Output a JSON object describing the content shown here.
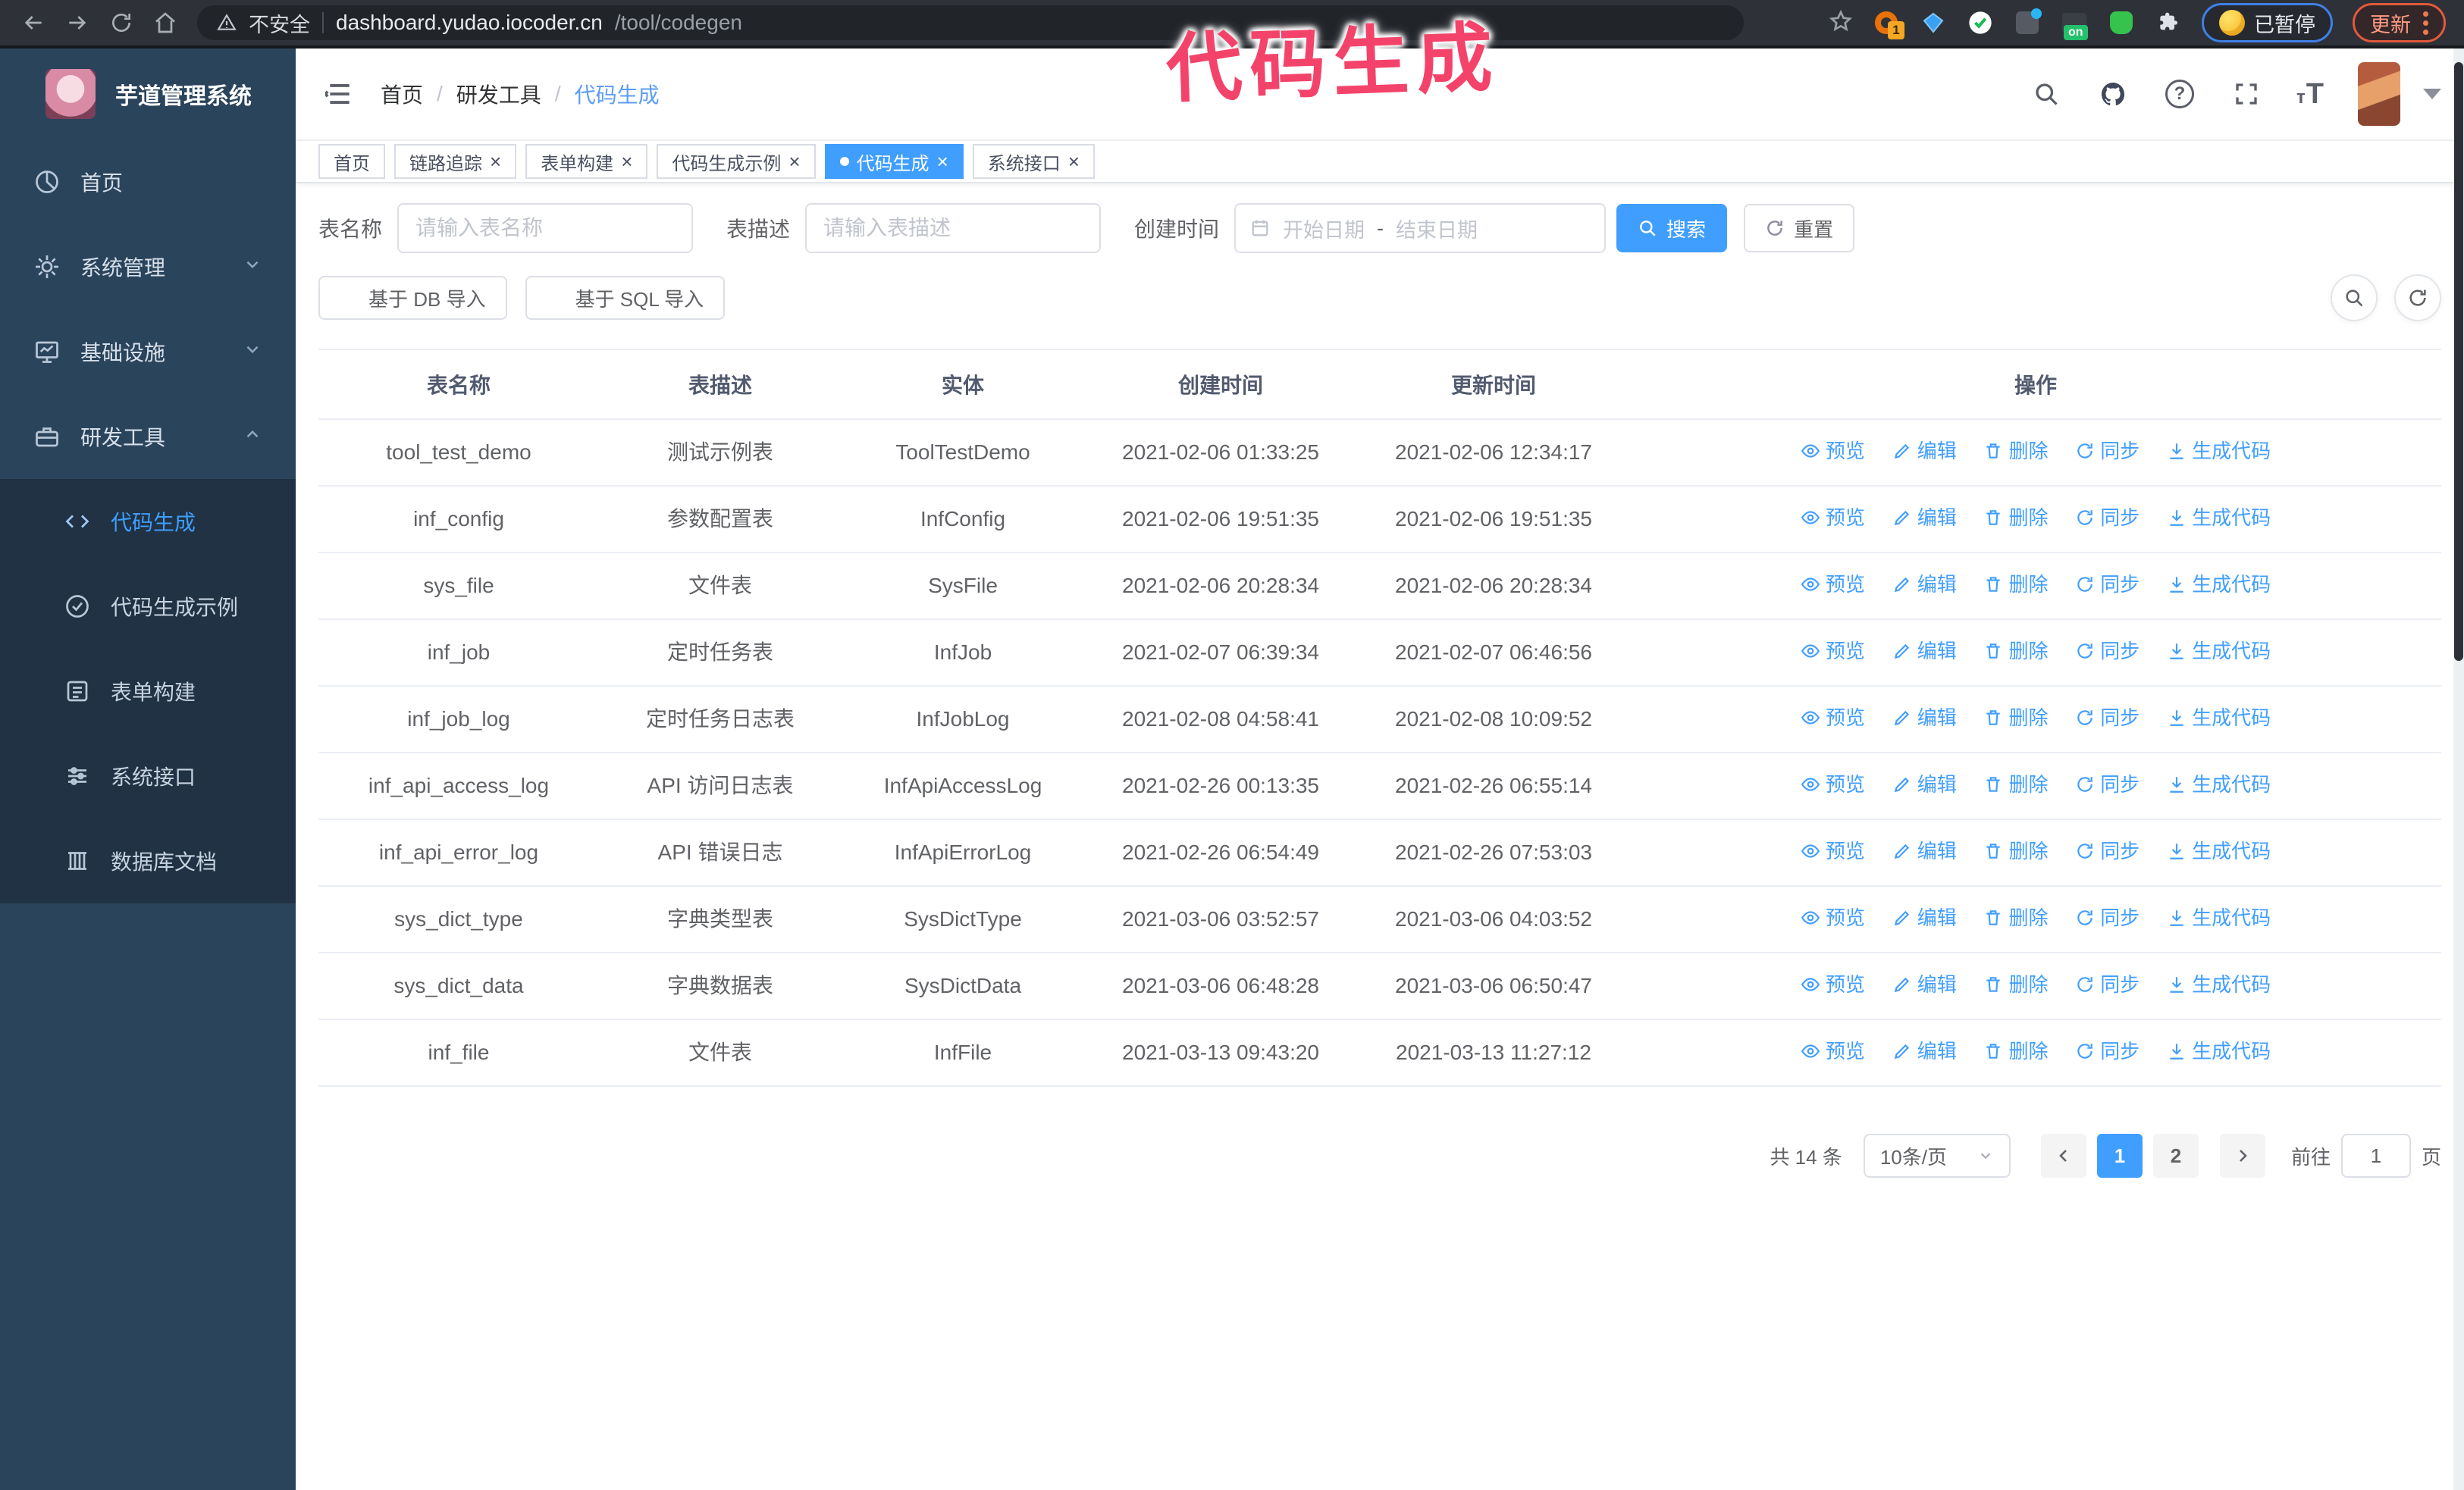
{
  "browser": {
    "security_label": "不安全",
    "url_host": "dashboard.yudao.iocoder.cn",
    "url_path": "/tool/codegen",
    "paused_chip": "已暂停",
    "update_chip": "更新"
  },
  "annotation": {
    "text": "代码生成",
    "color": "#f4436a"
  },
  "sidebar": {
    "logo_title": "芋道管理系统",
    "items": [
      {
        "label": "首页",
        "icon": "home-icon"
      },
      {
        "label": "系统管理",
        "icon": "gear-icon",
        "state": "collapsed"
      },
      {
        "label": "基础设施",
        "icon": "infrastructure-icon",
        "state": "collapsed"
      },
      {
        "label": "研发工具",
        "icon": "tools-icon",
        "state": "expanded"
      }
    ],
    "submenu": [
      {
        "label": "代码生成",
        "icon": "code-icon",
        "active": true
      },
      {
        "label": "代码生成示例",
        "icon": "example-check-icon",
        "active": false
      },
      {
        "label": "表单构建",
        "icon": "form-builder-icon",
        "active": false
      },
      {
        "label": "系统接口",
        "icon": "api-sliders-icon",
        "active": false
      },
      {
        "label": "数据库文档",
        "icon": "database-doc-icon",
        "active": false
      }
    ]
  },
  "breadcrumb": {
    "items": [
      "首页",
      "研发工具",
      "代码生成"
    ],
    "separator": "/"
  },
  "tabs": [
    {
      "label": "首页",
      "closable": false,
      "active": false
    },
    {
      "label": "链路追踪",
      "closable": true,
      "active": false
    },
    {
      "label": "表单构建",
      "closable": true,
      "active": false
    },
    {
      "label": "代码生成示例",
      "closable": true,
      "active": false
    },
    {
      "label": "代码生成",
      "closable": true,
      "active": true
    },
    {
      "label": "系统接口",
      "closable": true,
      "active": false
    }
  ],
  "filters": {
    "table_name_label": "表名称",
    "table_name_placeholder": "请输入表名称",
    "table_desc_label": "表描述",
    "table_desc_placeholder": "请输入表描述",
    "create_time_label": "创建时间",
    "date_start_placeholder": "开始日期",
    "date_separator": "-",
    "date_end_placeholder": "结束日期",
    "search_label": "搜索",
    "reset_label": "重置"
  },
  "toolbar": {
    "import_db_label": "基于 DB 导入",
    "import_sql_label": "基于 SQL 导入"
  },
  "table": {
    "columns": [
      "表名称",
      "表描述",
      "实体",
      "创建时间",
      "更新时间",
      "操作"
    ],
    "actions": [
      "预览",
      "编辑",
      "删除",
      "同步",
      "生成代码"
    ],
    "rows": [
      {
        "name": "tool_test_demo",
        "desc": "测试示例表",
        "entity": "ToolTestDemo",
        "created": "2021-02-06 01:33:25",
        "updated": "2021-02-06 12:34:17"
      },
      {
        "name": "inf_config",
        "desc": "参数配置表",
        "entity": "InfConfig",
        "created": "2021-02-06 19:51:35",
        "updated": "2021-02-06 19:51:35"
      },
      {
        "name": "sys_file",
        "desc": "文件表",
        "entity": "SysFile",
        "created": "2021-02-06 20:28:34",
        "updated": "2021-02-06 20:28:34"
      },
      {
        "name": "inf_job",
        "desc": "定时任务表",
        "entity": "InfJob",
        "created": "2021-02-07 06:39:34",
        "updated": "2021-02-07 06:46:56"
      },
      {
        "name": "inf_job_log",
        "desc": "定时任务日志表",
        "entity": "InfJobLog",
        "created": "2021-02-08 04:58:41",
        "updated": "2021-02-08 10:09:52"
      },
      {
        "name": "inf_api_access_log",
        "desc": "API 访问日志表",
        "entity": "InfApiAccessLog",
        "created": "2021-02-26 00:13:35",
        "updated": "2021-02-26 06:55:14"
      },
      {
        "name": "inf_api_error_log",
        "desc": "API 错误日志",
        "entity": "InfApiErrorLog",
        "created": "2021-02-26 06:54:49",
        "updated": "2021-02-26 07:53:03"
      },
      {
        "name": "sys_dict_type",
        "desc": "字典类型表",
        "entity": "SysDictType",
        "created": "2021-03-06 03:52:57",
        "updated": "2021-03-06 04:03:52"
      },
      {
        "name": "sys_dict_data",
        "desc": "字典数据表",
        "entity": "SysDictData",
        "created": "2021-03-06 06:48:28",
        "updated": "2021-03-06 06:50:47"
      },
      {
        "name": "inf_file",
        "desc": "文件表",
        "entity": "InfFile",
        "created": "2021-03-13 09:43:20",
        "updated": "2021-03-13 11:27:12"
      }
    ]
  },
  "pagination": {
    "total_label": "共 14 条",
    "page_size_label": "10条/页",
    "pages": [
      "1",
      "2"
    ],
    "active_page": "1",
    "goto_label": "前往",
    "goto_value": "1",
    "goto_suffix": "页"
  },
  "colors": {
    "accent": "#409EFF",
    "sidebar_bg": "#2a445c",
    "submenu_bg": "#203243"
  }
}
